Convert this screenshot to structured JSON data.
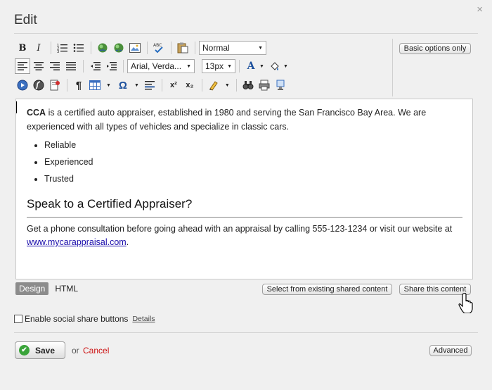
{
  "dialog": {
    "title": "Edit",
    "close_glyph": "×"
  },
  "toolbar": {
    "row1": {
      "bold": "B",
      "italic": "I",
      "paragraph_format": "Normal"
    },
    "row2": {
      "font_family": "Arial, Verda...",
      "font_size": "13px",
      "font_color_glyph": "A"
    },
    "row3": {
      "paragraph_mark": "¶",
      "omega": "Ω",
      "superscript": "x²",
      "subscript": "x₂"
    },
    "basic_options_label": "Basic options only"
  },
  "editor": {
    "intro_strong": "CCA",
    "intro_text": " is a certified auto appraiser, established in 1980 and serving the San Francisco Bay Area. We are experienced with all types of vehicles and specialize in classic cars.",
    "bullets": [
      "Reliable",
      "Experienced",
      "Trusted"
    ],
    "heading": "Speak to a Certified Appraiser?",
    "cta_text": "Get a phone consultation before going ahead with an appraisal by calling 555-123-1234 or visit our website at ",
    "link_text": "www.mycarappraisal.com",
    "cta_end": "."
  },
  "modes": {
    "design": "Design",
    "html": "HTML"
  },
  "shared": {
    "select_label": "Select from existing shared content",
    "share_label": "Share this content"
  },
  "social": {
    "label": "Enable social share buttons",
    "details": "Details",
    "checked": false
  },
  "footer": {
    "save": "Save",
    "or": "or",
    "cancel": "Cancel",
    "advanced": "Advanced"
  },
  "colors": {
    "save_check": "#3aa43a",
    "cancel": "#cc1111",
    "link": "#1a0dab"
  }
}
